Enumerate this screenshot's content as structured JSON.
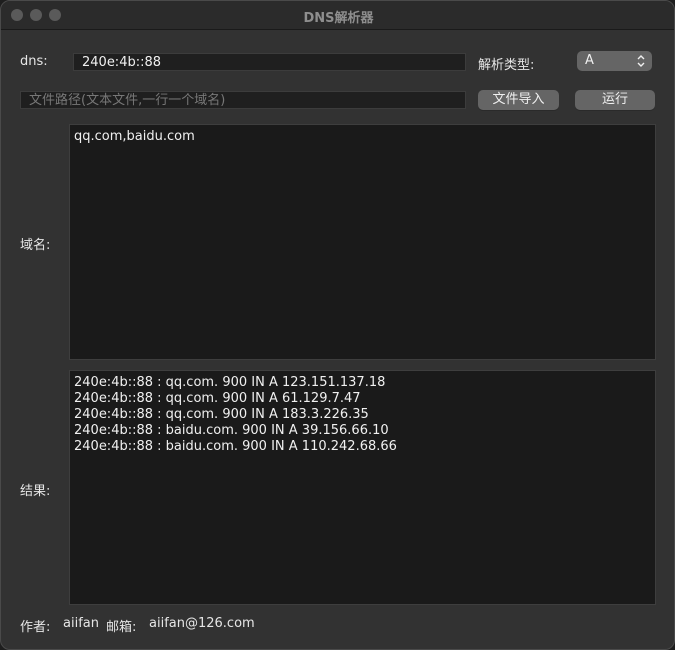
{
  "window": {
    "title": "DNS解析器"
  },
  "form": {
    "dns_label": "dns:",
    "dns_value": "240e:4b::88",
    "type_label": "解析类型:",
    "type_selected": "A",
    "filepath_placeholder": "文件路径(文本文件,一行一个域名)",
    "import_button": "文件导入",
    "run_button": "运行",
    "domains_label": "域名:",
    "domains_value": "qq.com,baidu.com",
    "results_label": "结果:",
    "results_lines": [
      "240e:4b::88 : qq.com. 900 IN A 123.151.137.18",
      "240e:4b::88 : qq.com. 900 IN A 61.129.7.47",
      "240e:4b::88 : qq.com. 900 IN A 183.3.226.35",
      "240e:4b::88 : baidu.com. 900 IN A 39.156.66.10",
      "240e:4b::88 : baidu.com. 900 IN A 110.242.68.66"
    ]
  },
  "footer": {
    "author_label": "作者:",
    "author_name": "aiifan",
    "email_label": "邮箱:",
    "email_value": "aiifan@126.com"
  },
  "colors": {
    "window_bg": "#323232",
    "field_bg": "#1f1f1f",
    "button_bg": "#656565"
  },
  "icons": {
    "select_chevron": "chevron-up-down-icon"
  }
}
